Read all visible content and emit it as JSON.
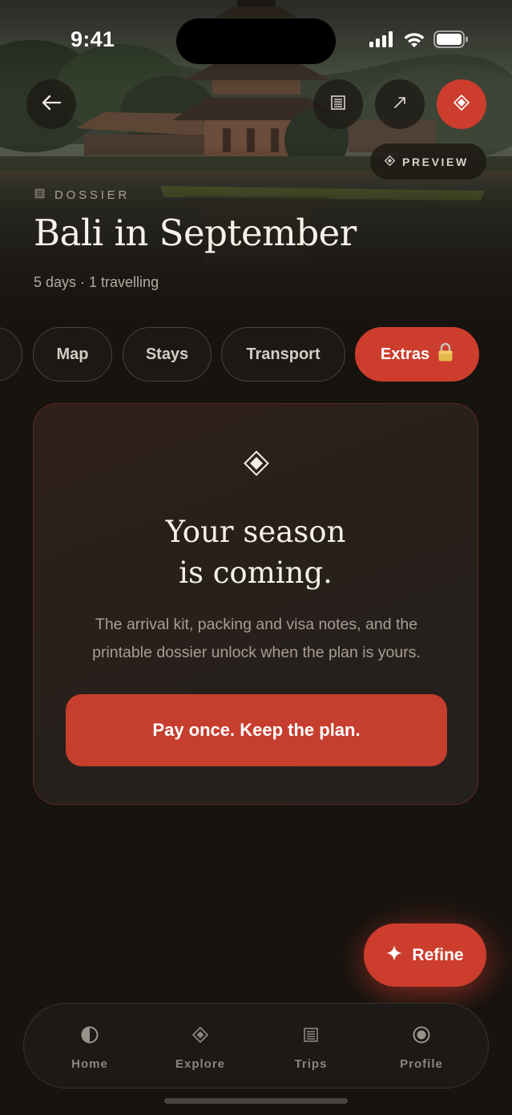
{
  "status_bar": {
    "time": "9:41"
  },
  "header": {
    "preview_label": "PREVIEW",
    "eyebrow": "DOSSIER",
    "title": "Bali in September",
    "subtitle": "5 days · 1 travelling"
  },
  "tabs": [
    {
      "label": "Map"
    },
    {
      "label": "Stays"
    },
    {
      "label": "Transport"
    },
    {
      "label": "Extras",
      "icon": "lock-icon",
      "active": true
    }
  ],
  "paywall": {
    "title_line1": "Your season",
    "title_line2": "is coming.",
    "body": "The arrival kit, packing and visa notes, and the printable dossier unlock when the plan is yours.",
    "cta_label": "Pay once. Keep the plan."
  },
  "refine_button": {
    "label": "Refine"
  },
  "bottom_nav": {
    "items": [
      {
        "label": "Home",
        "icon": "half-circle-icon"
      },
      {
        "label": "Explore",
        "icon": "diamond-icon"
      },
      {
        "label": "Trips",
        "icon": "list-icon"
      },
      {
        "label": "Profile",
        "icon": "circle-dot-icon"
      }
    ]
  },
  "colors": {
    "accent": "#cc3d2d",
    "background": "#17130f",
    "card": "#2a201b",
    "text_primary": "#f6f1ea",
    "text_muted": "#a79e95"
  }
}
